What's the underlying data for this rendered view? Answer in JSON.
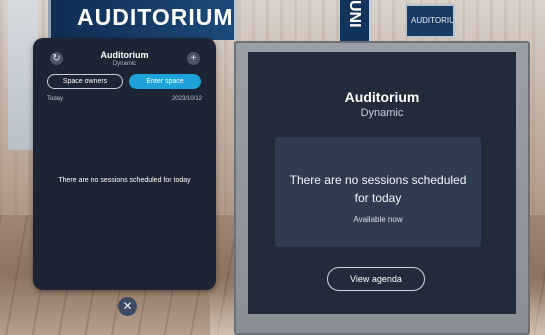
{
  "environment": {
    "banner_text": "AUDITORIUM",
    "pillar_text": "UNI",
    "small_sign_text": "AUDITORIUM"
  },
  "left_panel": {
    "title": "Auditorium",
    "subtitle": "Dynamic",
    "refresh_icon": "↻",
    "add_icon": "+",
    "space_owners_label": "Space owners",
    "enter_space_label": "Enter space",
    "today_label": "Today",
    "date": "2023/10/12",
    "empty_message": "There are no sessions scheduled for today"
  },
  "close_icon": "✕",
  "monitor": {
    "title": "Auditorium",
    "subtitle": "Dynamic",
    "card_message": "There are no sessions scheduled for today",
    "availability": "Available now",
    "view_agenda_label": "View agenda"
  },
  "colors": {
    "panel_bg": "#1d2433",
    "accent": "#1ea3d8",
    "screen_bg": "#212b3a",
    "card_bg": "#2f3c4f"
  }
}
